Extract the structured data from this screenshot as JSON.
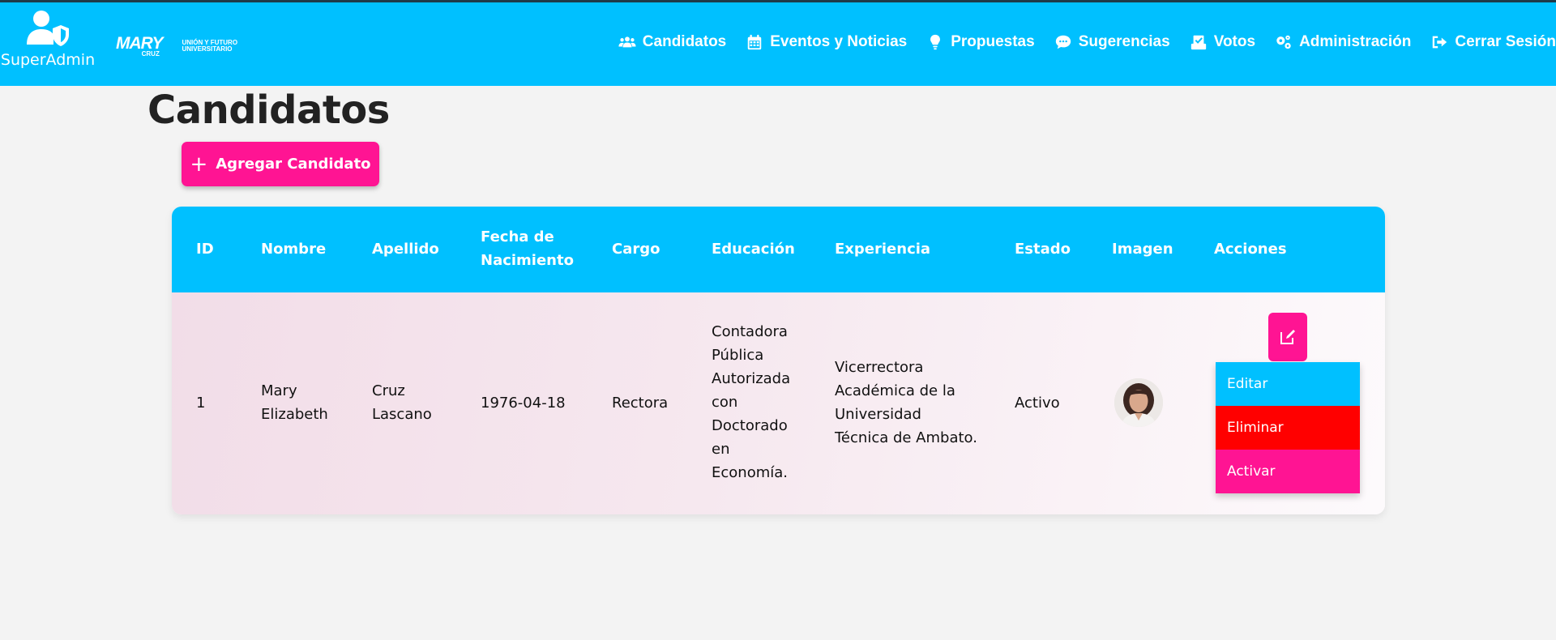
{
  "topbar": {
    "user_label": "SuperAdmin",
    "logo_main": "MARY",
    "logo_sub": "CRUZ",
    "logo_tag_1": "UNIÓN Y FUTURO",
    "logo_tag_2": "UNIVERSITARIO",
    "bg_color": "#00c0ff"
  },
  "nav": {
    "items": [
      {
        "label": "Candidatos",
        "icon": "users-icon"
      },
      {
        "label": "Eventos y Noticias",
        "icon": "calendar-icon"
      },
      {
        "label": "Propuestas",
        "icon": "lightbulb-icon"
      },
      {
        "label": "Sugerencias",
        "icon": "chat-icon"
      },
      {
        "label": "Votos",
        "icon": "vote-icon"
      },
      {
        "label": "Administración",
        "icon": "gears-icon"
      },
      {
        "label": "Cerrar Sesión",
        "icon": "logout-icon"
      }
    ]
  },
  "page": {
    "title": "Candidatos",
    "add_button_label": "Agregar Candidato",
    "accent_color": "#ff1493"
  },
  "table": {
    "headers": {
      "id": "ID",
      "nombre": "Nombre",
      "apellido": "Apellido",
      "fecha_1": "Fecha de",
      "fecha_2": "Nacimiento",
      "cargo": "Cargo",
      "educacion": "Educación",
      "experiencia": "Experiencia",
      "estado": "Estado",
      "imagen": "Imagen",
      "acciones": "Acciones"
    },
    "rows": [
      {
        "id": "1",
        "nombre_1": "Mary",
        "nombre_2": "Elizabeth",
        "apellido_1": "Cruz",
        "apellido_2": "Lascano",
        "fecha": "1976-04-18",
        "cargo": "Rectora",
        "educacion_lines": [
          "Contadora",
          "Pública",
          "Autorizada",
          "con",
          "Doctorado",
          "en",
          "Economía."
        ],
        "experiencia_lines": [
          "Vicerrectora",
          "Académica de la",
          "Universidad",
          "Técnica de Ambato."
        ],
        "estado": "Activo"
      }
    ]
  },
  "actions_menu": {
    "edit": "Editar",
    "delete": "Eliminar",
    "activate": "Activar",
    "colors": {
      "edit": "#00c0ff",
      "delete": "#ff0000",
      "activate": "#ff1493"
    }
  }
}
